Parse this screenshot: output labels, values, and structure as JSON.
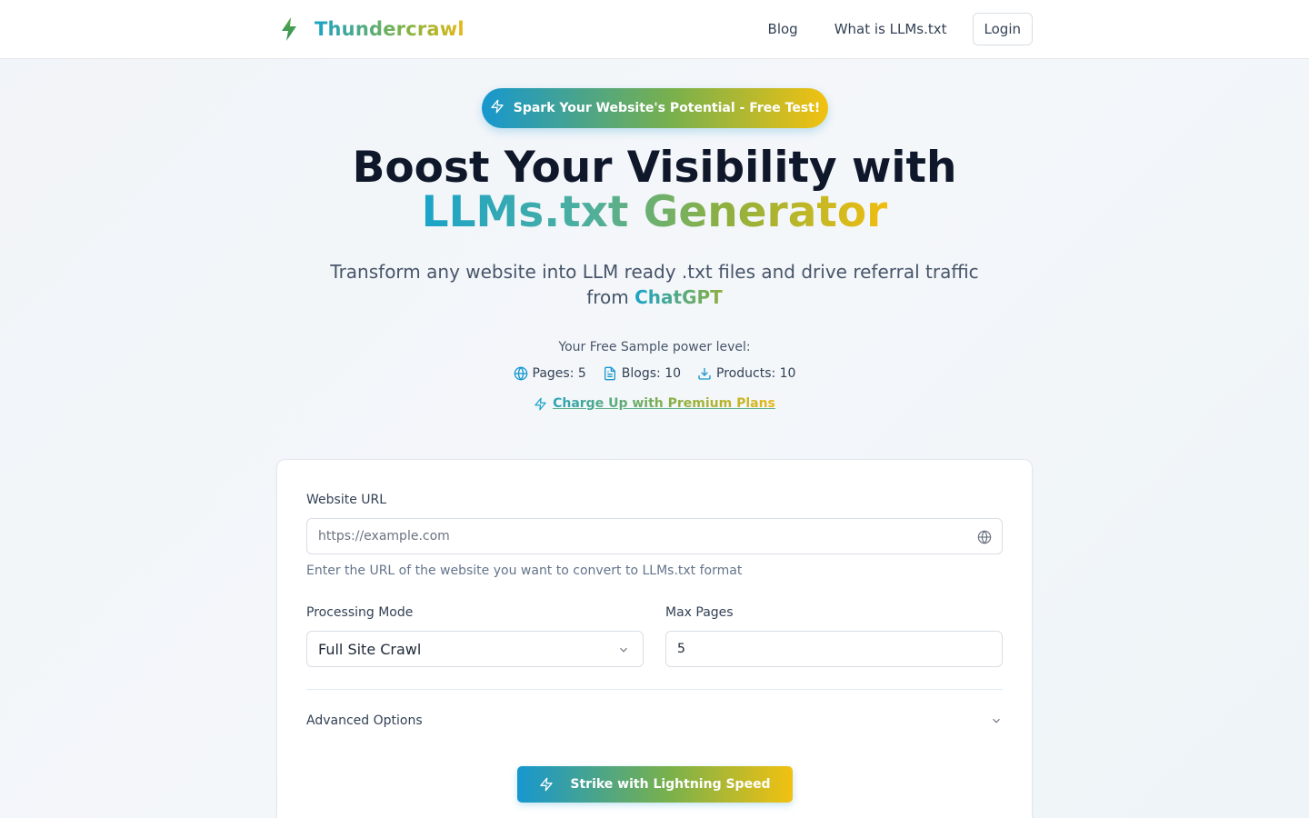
{
  "header": {
    "brand": "Thundercrawl",
    "nav": {
      "blog": "Blog",
      "what_is": "What is LLMs.txt",
      "login": "Login"
    }
  },
  "hero": {
    "pill": "Spark Your Website's Potential - Free Test!",
    "title_line1": "Boost Your Visibility with",
    "title_line2": "LLMs.txt Generator",
    "subtitle_prefix": "Transform any website into LLM ready .txt files and drive referral traffic from",
    "subtitle_highlight": "ChatGPT",
    "power_label": "Your Free Sample power level:",
    "stats": {
      "pages": "Pages: 5",
      "blogs": "Blogs: 10",
      "products": "Products: 10"
    },
    "premium_link": "Charge Up with Premium Plans"
  },
  "form": {
    "url_label": "Website URL",
    "url_placeholder": "https://example.com",
    "url_hint": "Enter the URL of the website you want to convert to LLMs.txt format",
    "mode_label": "Processing Mode",
    "mode_value": "Full Site Crawl",
    "max_pages_label": "Max Pages",
    "max_pages_value": "5",
    "advanced_label": "Advanced Options",
    "submit_label": "Strike with Lightning Speed"
  },
  "colors": {
    "accent_blue": "#1797cf",
    "accent_green": "#79b04c",
    "accent_yellow": "#f2c111",
    "heading": "#0f172a"
  },
  "icons": {
    "brand": "lightning-bolt-icon",
    "pill": "zap-icon",
    "pages": "globe-icon",
    "blogs": "file-text-icon",
    "products": "download-icon",
    "url_field": "globe-icon",
    "select": "chevron-down-icon",
    "advanced": "chevron-down-icon",
    "submit": "zap-icon"
  }
}
